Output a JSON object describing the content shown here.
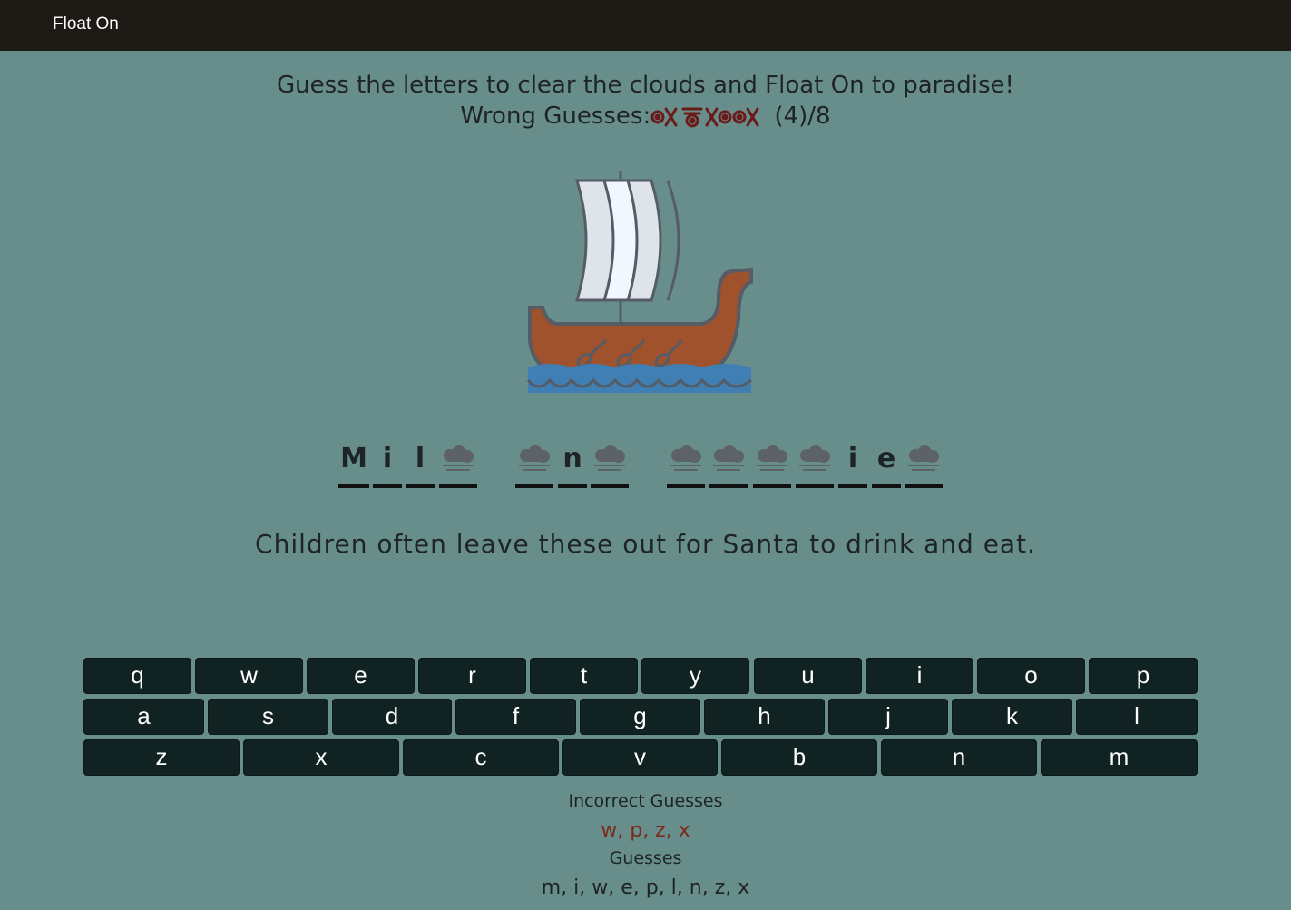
{
  "nav": {
    "brand": "Float On"
  },
  "instructions": "Guess the letters to clear the clouds and Float On to paradise!",
  "wrong": {
    "label": "Wrong Guesses:",
    "count_text": "(4)/8",
    "count": 4,
    "max": 8,
    "marker_color": "#6b1a1a"
  },
  "puzzle": {
    "words": [
      [
        "M",
        "i",
        "l",
        ""
      ],
      [
        "",
        "n",
        ""
      ],
      [
        "",
        "",
        "",
        "",
        "i",
        "e",
        ""
      ]
    ]
  },
  "clue": "Children often leave these out for Santa to drink and eat.",
  "keyboard": {
    "rows": [
      [
        "q",
        "w",
        "e",
        "r",
        "t",
        "y",
        "u",
        "i",
        "o",
        "p"
      ],
      [
        "a",
        "s",
        "d",
        "f",
        "g",
        "h",
        "j",
        "k",
        "l"
      ],
      [
        "z",
        "x",
        "c",
        "v",
        "b",
        "n",
        "m"
      ]
    ]
  },
  "incorrect": {
    "label": "Incorrect Guesses",
    "value": "w, p, z, x",
    "color": "#7a2a1a"
  },
  "guesses": {
    "label": "Guesses",
    "value": "m, i, w, e, p, l, n, z, x"
  },
  "colors": {
    "background": "#688e8b",
    "navbar": "#1e1b17",
    "key": "#112222",
    "hull": "#a0522d",
    "sail": "#dfe4ea",
    "water": "#3f7fb3"
  }
}
